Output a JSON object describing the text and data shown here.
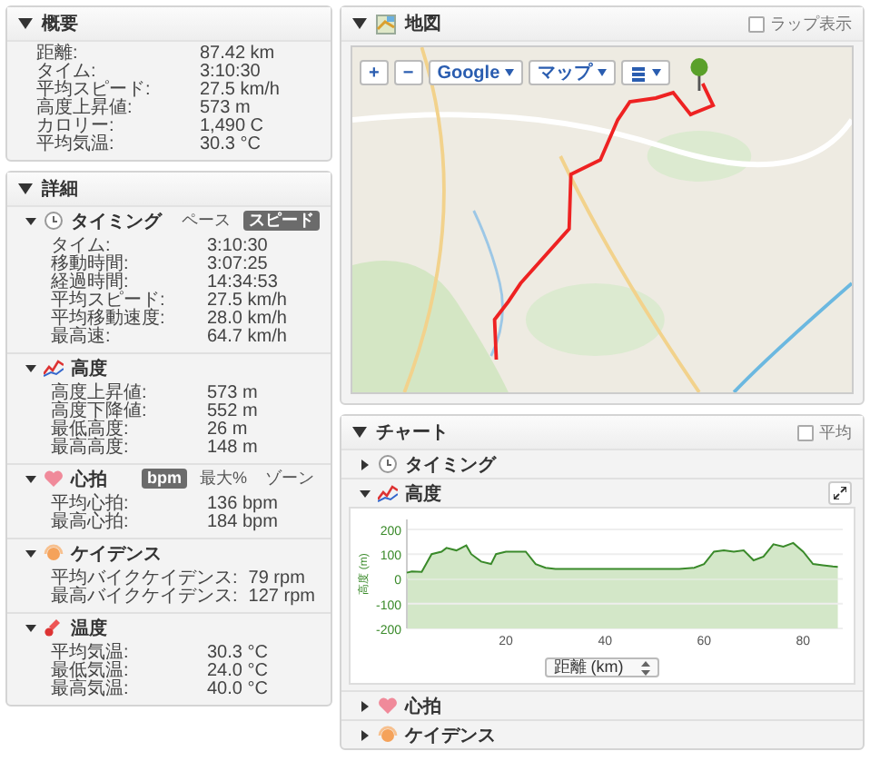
{
  "summary": {
    "title": "概要",
    "expanded": true,
    "rows": [
      {
        "label": "距離:",
        "value": "87.42 km"
      },
      {
        "label": "タイム:",
        "value": "3:10:30"
      },
      {
        "label": "平均スピード:",
        "value": "27.5 km/h"
      },
      {
        "label": "高度上昇値:",
        "value": "573 m"
      },
      {
        "label": "カロリー:",
        "value": "1,490 C"
      },
      {
        "label": "平均気温:",
        "value": "30.3 °C"
      }
    ]
  },
  "details": {
    "title": "詳細",
    "expanded": true,
    "sections": [
      {
        "kind": "timing",
        "title": "タイミング",
        "expanded": true,
        "toggles": [
          {
            "label": "ペース",
            "selected": false
          },
          {
            "label": "スピード",
            "selected": true
          }
        ],
        "rows": [
          {
            "label": "タイム:",
            "value": "3:10:30"
          },
          {
            "label": "移動時間:",
            "value": "3:07:25"
          },
          {
            "label": "経過時間:",
            "value": "14:34:53"
          },
          {
            "label": "平均スピード:",
            "value": "27.5 km/h"
          },
          {
            "label": "平均移動速度:",
            "value": "28.0 km/h"
          },
          {
            "label": "最高速:",
            "value": "64.7 km/h"
          }
        ]
      },
      {
        "kind": "altitude",
        "title": "高度",
        "expanded": true,
        "rows": [
          {
            "label": "高度上昇値:",
            "value": "573 m"
          },
          {
            "label": "高度下降値:",
            "value": "552 m"
          },
          {
            "label": "最低高度:",
            "value": "26 m"
          },
          {
            "label": "最高高度:",
            "value": "148 m"
          }
        ]
      },
      {
        "kind": "heart",
        "title": "心拍",
        "expanded": true,
        "toggles": [
          {
            "label": "bpm",
            "selected": true
          },
          {
            "label": "最大%",
            "selected": false
          },
          {
            "label": "ゾーン",
            "selected": false
          }
        ],
        "rows": [
          {
            "label": "平均心拍:",
            "value": "136 bpm"
          },
          {
            "label": "最高心拍:",
            "value": "184 bpm"
          }
        ]
      },
      {
        "kind": "cadence",
        "title": "ケイデンス",
        "expanded": true,
        "rows": [
          {
            "label": "平均バイクケイデンス:",
            "value": "79 rpm"
          },
          {
            "label": "最高バイクケイデンス:",
            "value": "127 rpm"
          }
        ]
      },
      {
        "kind": "temperature",
        "title": "温度",
        "expanded": true,
        "rows": [
          {
            "label": "平均気温:",
            "value": "30.3 °C"
          },
          {
            "label": "最低気温:",
            "value": "24.0 °C"
          },
          {
            "label": "最高気温:",
            "value": "40.0 °C"
          }
        ]
      }
    ]
  },
  "map": {
    "title": "地図",
    "expanded": true,
    "lap_toggle": {
      "label": "ラップ表示",
      "checked": false
    },
    "controls": {
      "zoom_in": "+",
      "zoom_out": "−",
      "provider": "Google",
      "type": "マップ"
    }
  },
  "chart_panel": {
    "title": "チャート",
    "expanded": true,
    "average": {
      "label": "平均",
      "checked": false
    },
    "sections": [
      {
        "kind": "timing",
        "title": "タイミング",
        "expanded": false
      },
      {
        "kind": "altitude",
        "title": "高度",
        "expanded": true,
        "axis_selector": "距離 (km)",
        "chart_data": {
          "type": "area",
          "ylabel": "高度 (m)",
          "xlim": [
            0,
            88
          ],
          "ylim": [
            -200,
            240
          ],
          "xticks": [
            20,
            40,
            60,
            80
          ],
          "yticks": [
            -200,
            -100,
            0,
            100,
            200
          ],
          "x": [
            0,
            1,
            3,
            5,
            7,
            8,
            10,
            12,
            13,
            15,
            17,
            18,
            20,
            22,
            24,
            26,
            28,
            30,
            35,
            40,
            45,
            50,
            55,
            58,
            60,
            62,
            64,
            66,
            68,
            70,
            72,
            74,
            76,
            78,
            80,
            82,
            84,
            86,
            87
          ],
          "grid": true,
          "series": [
            {
              "color": "#3a8a2a",
              "values": [
                25,
                30,
                28,
                100,
                110,
                125,
                115,
                135,
                100,
                70,
                60,
                100,
                110,
                110,
                110,
                60,
                45,
                40,
                40,
                40,
                40,
                40,
                40,
                45,
                60,
                110,
                115,
                110,
                115,
                75,
                90,
                140,
                130,
                145,
                110,
                60,
                55,
                50,
                48
              ]
            }
          ]
        }
      },
      {
        "kind": "heart",
        "title": "心拍",
        "expanded": false
      },
      {
        "kind": "cadence",
        "title": "ケイデンス",
        "expanded": false
      }
    ]
  }
}
